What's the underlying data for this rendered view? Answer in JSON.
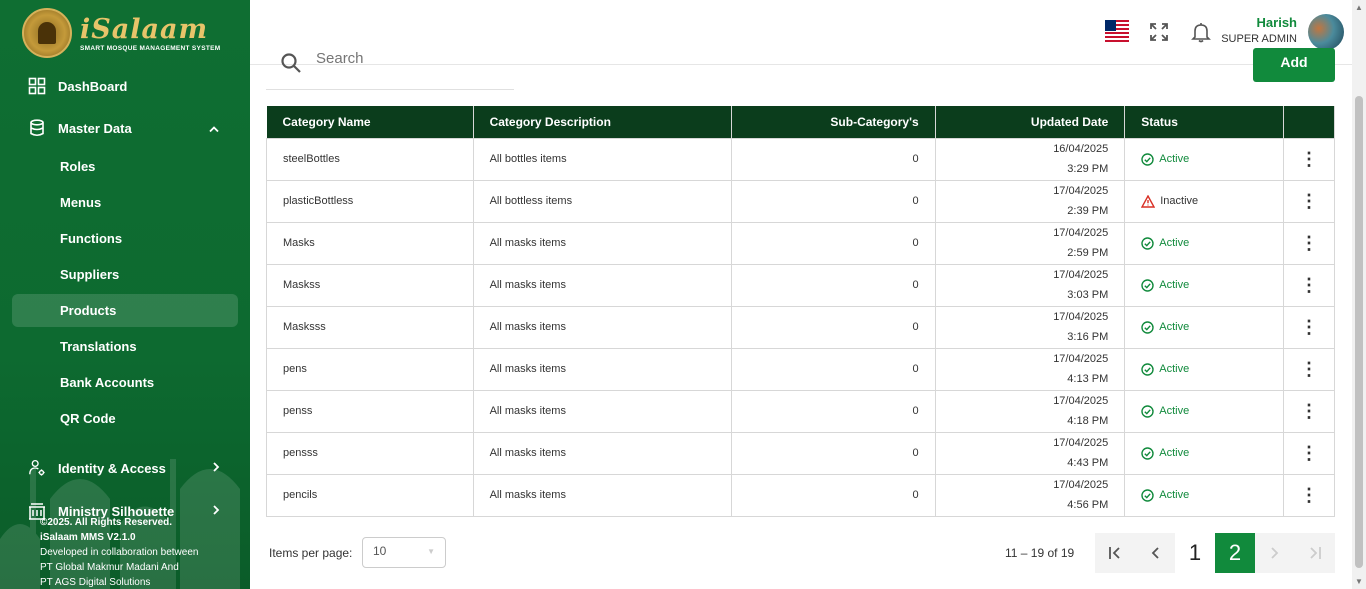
{
  "brand": {
    "title": "iSalaam",
    "subtitle": "SMART MOSQUE MANAGEMENT SYSTEM"
  },
  "sidebar": {
    "items": [
      {
        "label": "DashBoard",
        "icon": "grid-icon"
      },
      {
        "label": "Master Data",
        "icon": "database-icon",
        "expanded": true
      }
    ],
    "subitems": [
      {
        "label": "Roles"
      },
      {
        "label": "Menus"
      },
      {
        "label": "Functions"
      },
      {
        "label": "Suppliers"
      },
      {
        "label": "Products",
        "active": true
      },
      {
        "label": "Translations"
      },
      {
        "label": "Bank Accounts"
      },
      {
        "label": "QR Code"
      }
    ],
    "identity": {
      "label": "Identity & Access",
      "icon": "user-gear-icon"
    },
    "ministry": {
      "label": "Ministry Silhouette",
      "icon": "building-icon"
    }
  },
  "footer": {
    "copyright": "©2025. All Rights Reserved.",
    "version": "iSalaam MMS V2.1.0",
    "collab": "Developed in collaboration between",
    "org1": "PT Global Makmur Madani And",
    "org2": "PT AGS Digital Solutions"
  },
  "header": {
    "user_name": "Harish",
    "user_role": "SUPER ADMIN"
  },
  "toolbar": {
    "search_placeholder": "Search",
    "add_label": "Add"
  },
  "table": {
    "columns": [
      "Category Name",
      "Category Description",
      "Sub-Category's",
      "Updated Date",
      "Status"
    ],
    "rows": [
      {
        "name": "steelBottles",
        "desc": "All bottles items",
        "sub": "0",
        "date": "16/04/2025",
        "time": "3:29 PM",
        "status": "Active"
      },
      {
        "name": "plasticBottless",
        "desc": "All bottless items",
        "sub": "0",
        "date": "17/04/2025",
        "time": "2:39 PM",
        "status": "Inactive"
      },
      {
        "name": "Masks",
        "desc": "All masks items",
        "sub": "0",
        "date": "17/04/2025",
        "time": "2:59 PM",
        "status": "Active"
      },
      {
        "name": "Maskss",
        "desc": "All masks items",
        "sub": "0",
        "date": "17/04/2025",
        "time": "3:03 PM",
        "status": "Active"
      },
      {
        "name": "Masksss",
        "desc": "All masks items",
        "sub": "0",
        "date": "17/04/2025",
        "time": "3:16 PM",
        "status": "Active"
      },
      {
        "name": "pens",
        "desc": "All masks items",
        "sub": "0",
        "date": "17/04/2025",
        "time": "4:13 PM",
        "status": "Active"
      },
      {
        "name": "penss",
        "desc": "All masks items",
        "sub": "0",
        "date": "17/04/2025",
        "time": "4:18 PM",
        "status": "Active"
      },
      {
        "name": "pensss",
        "desc": "All masks items",
        "sub": "0",
        "date": "17/04/2025",
        "time": "4:43 PM",
        "status": "Active"
      },
      {
        "name": "pencils",
        "desc": "All masks items",
        "sub": "0",
        "date": "17/04/2025",
        "time": "4:56 PM",
        "status": "Active"
      }
    ]
  },
  "pager": {
    "items_label": "Items per page:",
    "page_size": "10",
    "range": "11 – 19 of 19",
    "pages": [
      "1",
      "2"
    ],
    "current_page": "2"
  },
  "colors": {
    "primary": "#118a3c",
    "sidebar": "#0f6e32",
    "table_header": "#0b3d1c",
    "inactive_warning": "#d93025"
  }
}
